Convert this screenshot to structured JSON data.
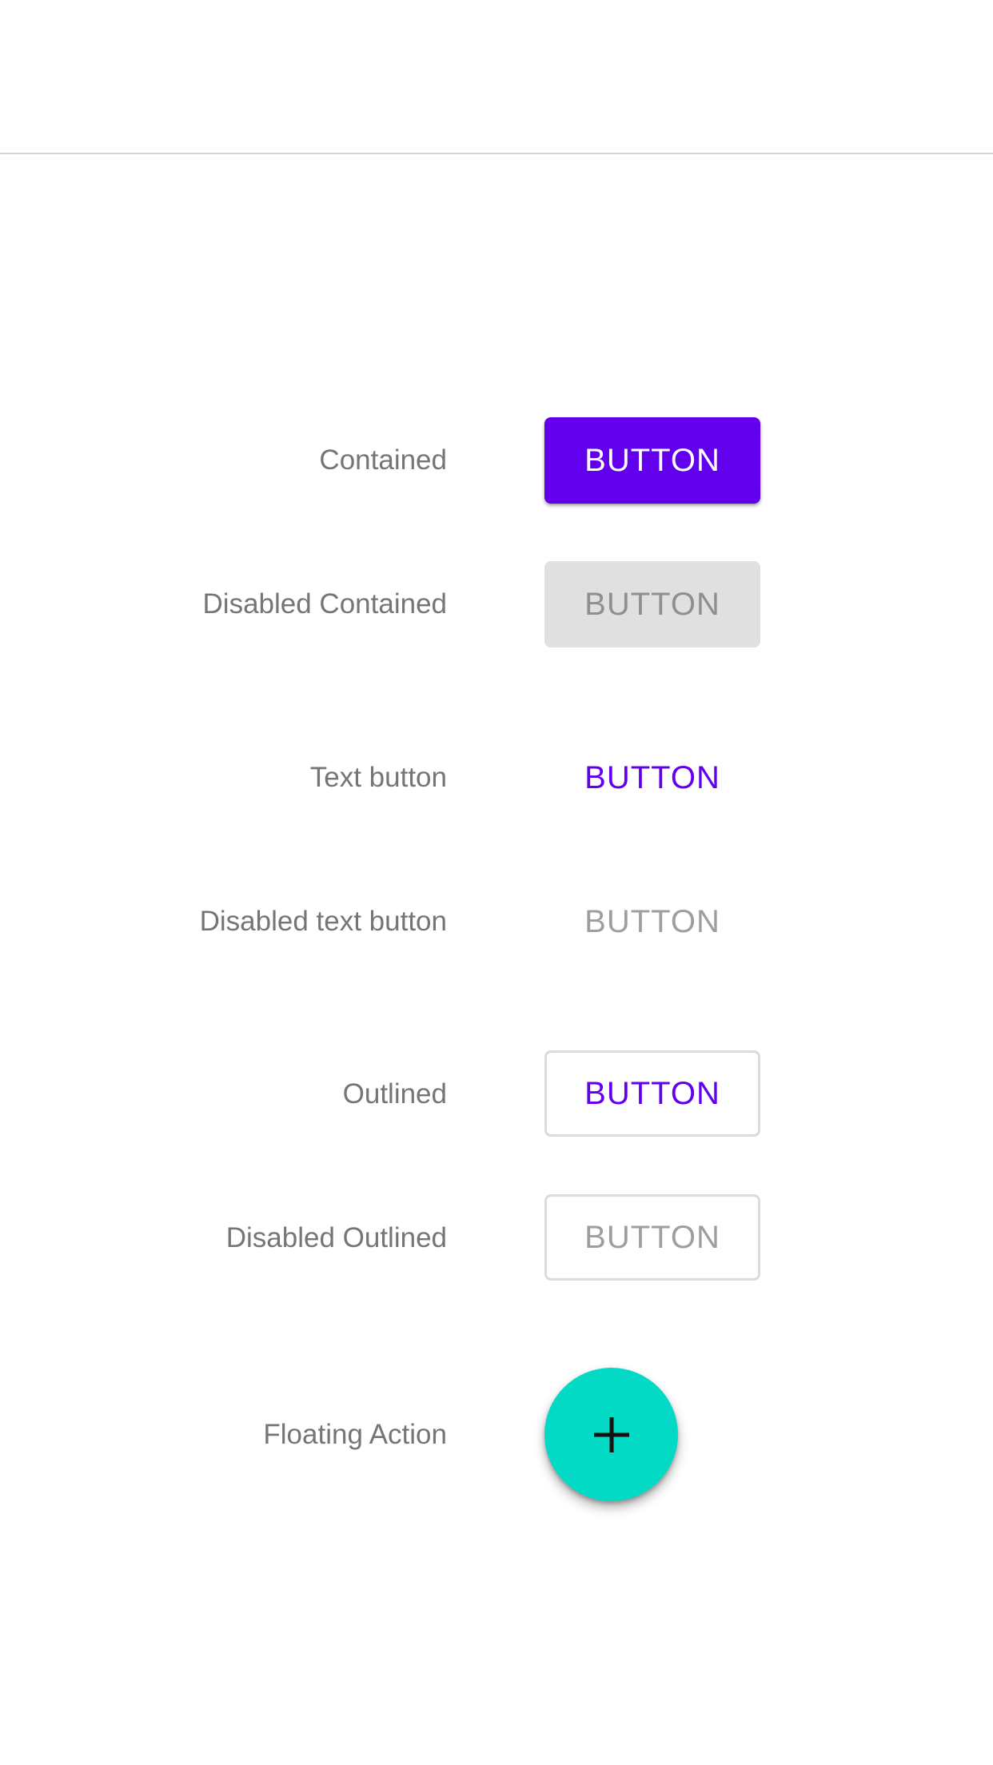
{
  "rows": [
    {
      "label": "Contained",
      "button": "BUTTON"
    },
    {
      "label": "Disabled Contained",
      "button": "BUTTON"
    },
    {
      "label": "Text button",
      "button": "BUTTON"
    },
    {
      "label": "Disabled text button",
      "button": "BUTTON"
    },
    {
      "label": "Outlined",
      "button": "BUTTON"
    },
    {
      "label": "Disabled Outlined",
      "button": "BUTTON"
    },
    {
      "label": "Floating Action",
      "button": "add-icon"
    }
  ],
  "colors": {
    "primary": "#6200ee",
    "secondary": "#03dac5",
    "disabled_fill": "#e0e0e0",
    "label_text": "#757575"
  }
}
